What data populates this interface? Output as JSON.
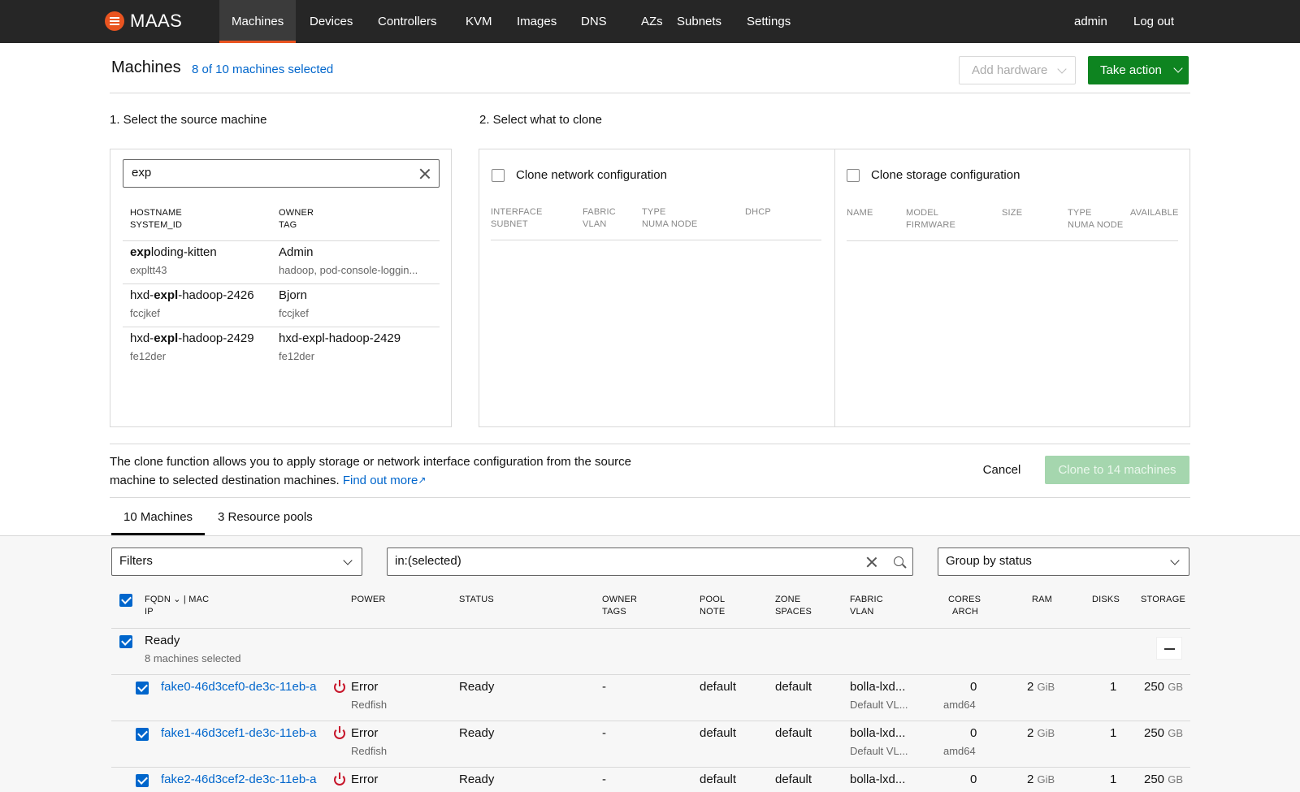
{
  "nav": {
    "brand": "MAAS",
    "items": [
      "Machines",
      "Devices",
      "Controllers",
      "KVM",
      "Images",
      "DNS",
      "AZs",
      "Subnets",
      "Settings"
    ],
    "user": "admin",
    "logout": "Log out"
  },
  "header": {
    "title": "Machines",
    "selected": "8 of 10 machines selected",
    "add_hardware": "Add hardware",
    "take_action": "Take action"
  },
  "clone": {
    "step1": "1. Select the source machine",
    "step2": "2. Select what to clone",
    "search_value": "exp",
    "src_headers": {
      "hostname": "HOSTNAME",
      "system_id": "SYSTEM_ID",
      "owner": "OWNER",
      "tag": "TAG"
    },
    "sources": [
      {
        "host_pre": "",
        "host_match": "exp",
        "host_post": "loding-kitten",
        "system_id": "expltt43",
        "owner": "Admin",
        "tag": "hadoop, pod-console-loggin..."
      },
      {
        "host_pre": "hxd-",
        "host_match": "expl",
        "host_post": "-hadoop-2426",
        "system_id": "fccjkef",
        "owner": "Bjorn",
        "tag": "fccjkef"
      },
      {
        "host_pre": "hxd-",
        "host_match": "expl",
        "host_post": "-hadoop-2429",
        "system_id": "fe12der",
        "owner": "hxd-expl-hadoop-2429",
        "tag": "fe12der"
      }
    ],
    "network_label": "Clone network configuration",
    "network_headers": {
      "interface": "INTERFACE",
      "subnet": "SUBNET",
      "fabric": "FABRIC",
      "vlan": "VLAN",
      "type": "TYPE",
      "numa": "NUMA NODE",
      "dhcp": "DHCP"
    },
    "storage_label": "Clone storage configuration",
    "storage_headers": {
      "name": "NAME",
      "model": "MODEL",
      "firmware": "FIRMWARE",
      "size": "SIZE",
      "type": "TYPE",
      "numa": "NUMA NODE",
      "available": "AVAILABLE"
    },
    "info_text": "The clone function allows you to apply storage or network interface configuration from the source machine to selected destination machines.",
    "info_link": "Find out more",
    "cancel": "Cancel",
    "submit": "Clone to 14 machines"
  },
  "tabs": [
    "10 Machines",
    "3 Resource pools"
  ],
  "list": {
    "filters": "Filters",
    "search_value": "in:(selected)",
    "group_by": "Group by status",
    "headers": {
      "fqdn": "FQDN",
      "mac": "| MAC",
      "ip": "IP",
      "power": "POWER",
      "status": "STATUS",
      "owner": "OWNER",
      "tags": "TAGS",
      "pool": "POOL",
      "note": "NOTE",
      "zone": "ZONE",
      "spaces": "SPACES",
      "fabric": "FABRIC",
      "vlan": "VLAN",
      "cores": "CORES",
      "arch": "ARCH",
      "ram": "RAM",
      "disks": "DISKS",
      "storage": "STORAGE"
    },
    "group": {
      "name": "Ready",
      "count": "8 machines selected"
    },
    "rows": [
      {
        "fqdn": "fake0-46d3cef0-de3c-11eb-a",
        "power": "Error",
        "power_type": "Redfish",
        "status": "Ready",
        "owner": "-",
        "pool": "default",
        "zone": "default",
        "fabric": "bolla-lxd...",
        "vlan": "Default VL...",
        "cores": "0",
        "arch": "amd64",
        "ram": "2",
        "ram_unit": "GiB",
        "disks": "1",
        "storage": "250",
        "storage_unit": "GB"
      },
      {
        "fqdn": "fake1-46d3cef1-de3c-11eb-a",
        "power": "Error",
        "power_type": "Redfish",
        "status": "Ready",
        "owner": "-",
        "pool": "default",
        "zone": "default",
        "fabric": "bolla-lxd...",
        "vlan": "Default VL...",
        "cores": "0",
        "arch": "amd64",
        "ram": "2",
        "ram_unit": "GiB",
        "disks": "1",
        "storage": "250",
        "storage_unit": "GB"
      },
      {
        "fqdn": "fake2-46d3cef2-de3c-11eb-a",
        "power": "Error",
        "power_type": "",
        "status": "Ready",
        "owner": "-",
        "pool": "default",
        "zone": "default",
        "fabric": "bolla-lxd...",
        "vlan": "",
        "cores": "0",
        "arch": "",
        "ram": "2",
        "ram_unit": "GiB",
        "disks": "1",
        "storage": "250",
        "storage_unit": "GB"
      }
    ]
  },
  "colors": {
    "brand": "#e95420",
    "link": "#0066cc",
    "positive": "#0e8420",
    "error": "#c7162b"
  }
}
